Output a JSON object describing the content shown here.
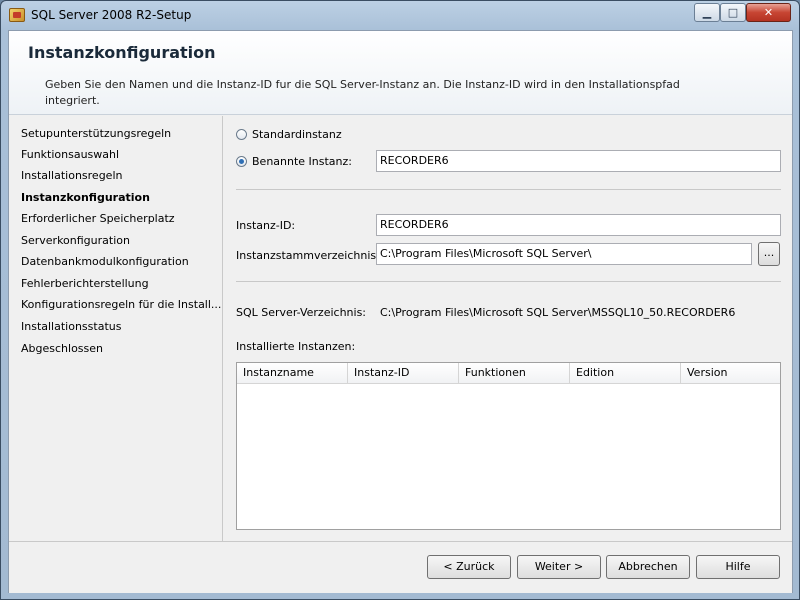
{
  "window": {
    "title": "SQL Server 2008 R2-Setup",
    "min_glyph": "▁",
    "max_glyph": "□",
    "close_glyph": "✕"
  },
  "header": {
    "title": "Instanzkonfiguration",
    "description": "Geben Sie den Namen und die Instanz-ID fur die SQL Server-Instanz an. Die Instanz-ID wird in den Installationspfad integriert."
  },
  "steps": [
    {
      "label": "Setupunterstützungsregeln",
      "active": false
    },
    {
      "label": "Funktionsauswahl",
      "active": false
    },
    {
      "label": "Installationsregeln",
      "active": false
    },
    {
      "label": "Instanzkonfiguration",
      "active": true
    },
    {
      "label": "Erforderlicher Speicherplatz",
      "active": false
    },
    {
      "label": "Serverkonfiguration",
      "active": false
    },
    {
      "label": "Datenbankmodulkonfiguration",
      "active": false
    },
    {
      "label": "Fehlerberichterstellung",
      "active": false
    },
    {
      "label": "Konfigurationsregeln für die Install...",
      "active": false
    },
    {
      "label": "Installationsstatus",
      "active": false
    },
    {
      "label": "Abgeschlossen",
      "active": false
    }
  ],
  "form": {
    "default_instance_label": "Standardinstanz",
    "named_instance_label": "Benannte Instanz:",
    "named_instance_value": "RECORDER6",
    "instance_id_label": "Instanz-ID:",
    "instance_id_value": "RECORDER6",
    "root_dir_label": "Instanzstammverzeichnis:",
    "root_dir_value": "C:\\Program Files\\Microsoft SQL Server\\",
    "browse_label": "...",
    "sql_dir_label": "SQL Server-Verzeichnis:",
    "sql_dir_value": "C:\\Program Files\\Microsoft SQL Server\\MSSQL10_50.RECORDER6",
    "installed_label": "Installierte Instanzen:"
  },
  "grid": {
    "columns": [
      "Instanzname",
      "Instanz-ID",
      "Funktionen",
      "Edition",
      "Version"
    ],
    "rows": []
  },
  "buttons": {
    "back": "< Zurück",
    "next": "Weiter >",
    "cancel": "Abbrechen",
    "help": "Hilfe"
  }
}
